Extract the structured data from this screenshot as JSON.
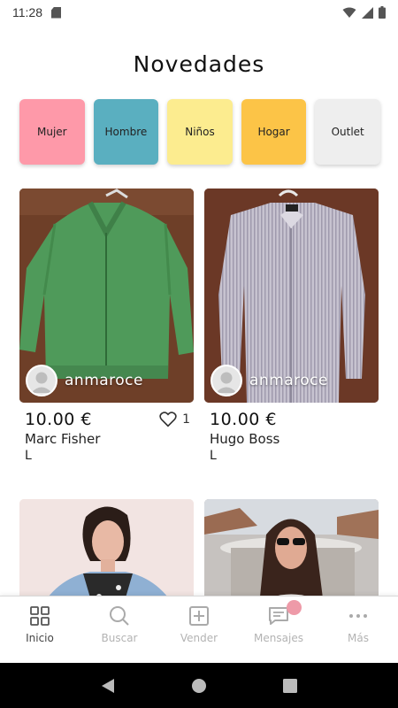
{
  "status_bar": {
    "time": "11:28"
  },
  "page": {
    "title": "Novedades"
  },
  "colors": {
    "mujer": "#fe99a9",
    "hombre": "#5aafc0",
    "ninos": "#fcec8f",
    "hogar": "#fcc447",
    "outlet": "#eeeeee",
    "badge": "#ee9aa8"
  },
  "categories": [
    {
      "label": "Mujer"
    },
    {
      "label": "Hombre"
    },
    {
      "label": "Niños"
    },
    {
      "label": "Hogar"
    },
    {
      "label": "Outlet"
    }
  ],
  "products": [
    {
      "seller": "anmaroce",
      "price": "10.00 €",
      "brand": "Marc Fisher",
      "size": "L",
      "likes": "1",
      "image": "green-knit-zip-cardigan"
    },
    {
      "seller": "anmaroce",
      "price": "10.00 €",
      "brand": "Hugo Boss",
      "size": "L",
      "image": "striped-dress-shirt"
    },
    {
      "image": "woman-denim-jacket"
    },
    {
      "image": "woman-sunglasses-fountain"
    }
  ],
  "bottom_nav": [
    {
      "label": "Inicio",
      "icon": "grid-icon",
      "active": true
    },
    {
      "label": "Buscar",
      "icon": "search-icon"
    },
    {
      "label": "Vender",
      "icon": "plus-square-icon"
    },
    {
      "label": "Mensajes",
      "icon": "message-icon",
      "badge": true
    },
    {
      "label": "Más",
      "icon": "more-icon"
    }
  ]
}
